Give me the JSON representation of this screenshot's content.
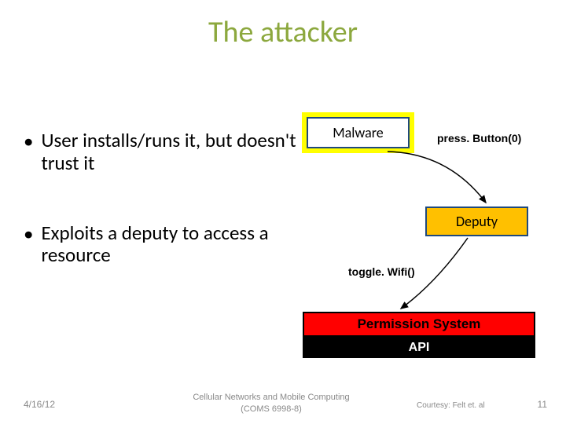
{
  "title": "The attacker",
  "bullets": [
    "User installs/runs it, but doesn't trust it",
    "Exploits a deputy to access a resource"
  ],
  "diagram": {
    "malware": "Malware",
    "press_label": "press. Button(0)",
    "deputy": "Deputy",
    "toggle_label": "toggle. Wifi()",
    "permission": "Permission System",
    "api": "API"
  },
  "footer": {
    "date": "4/16/12",
    "center_line1": "Cellular Networks and Mobile Computing",
    "center_line2": "(COMS 6998-8)",
    "credit_prefix": "Courtesy:",
    "credit_name": "Felt et. al",
    "page": "11"
  }
}
